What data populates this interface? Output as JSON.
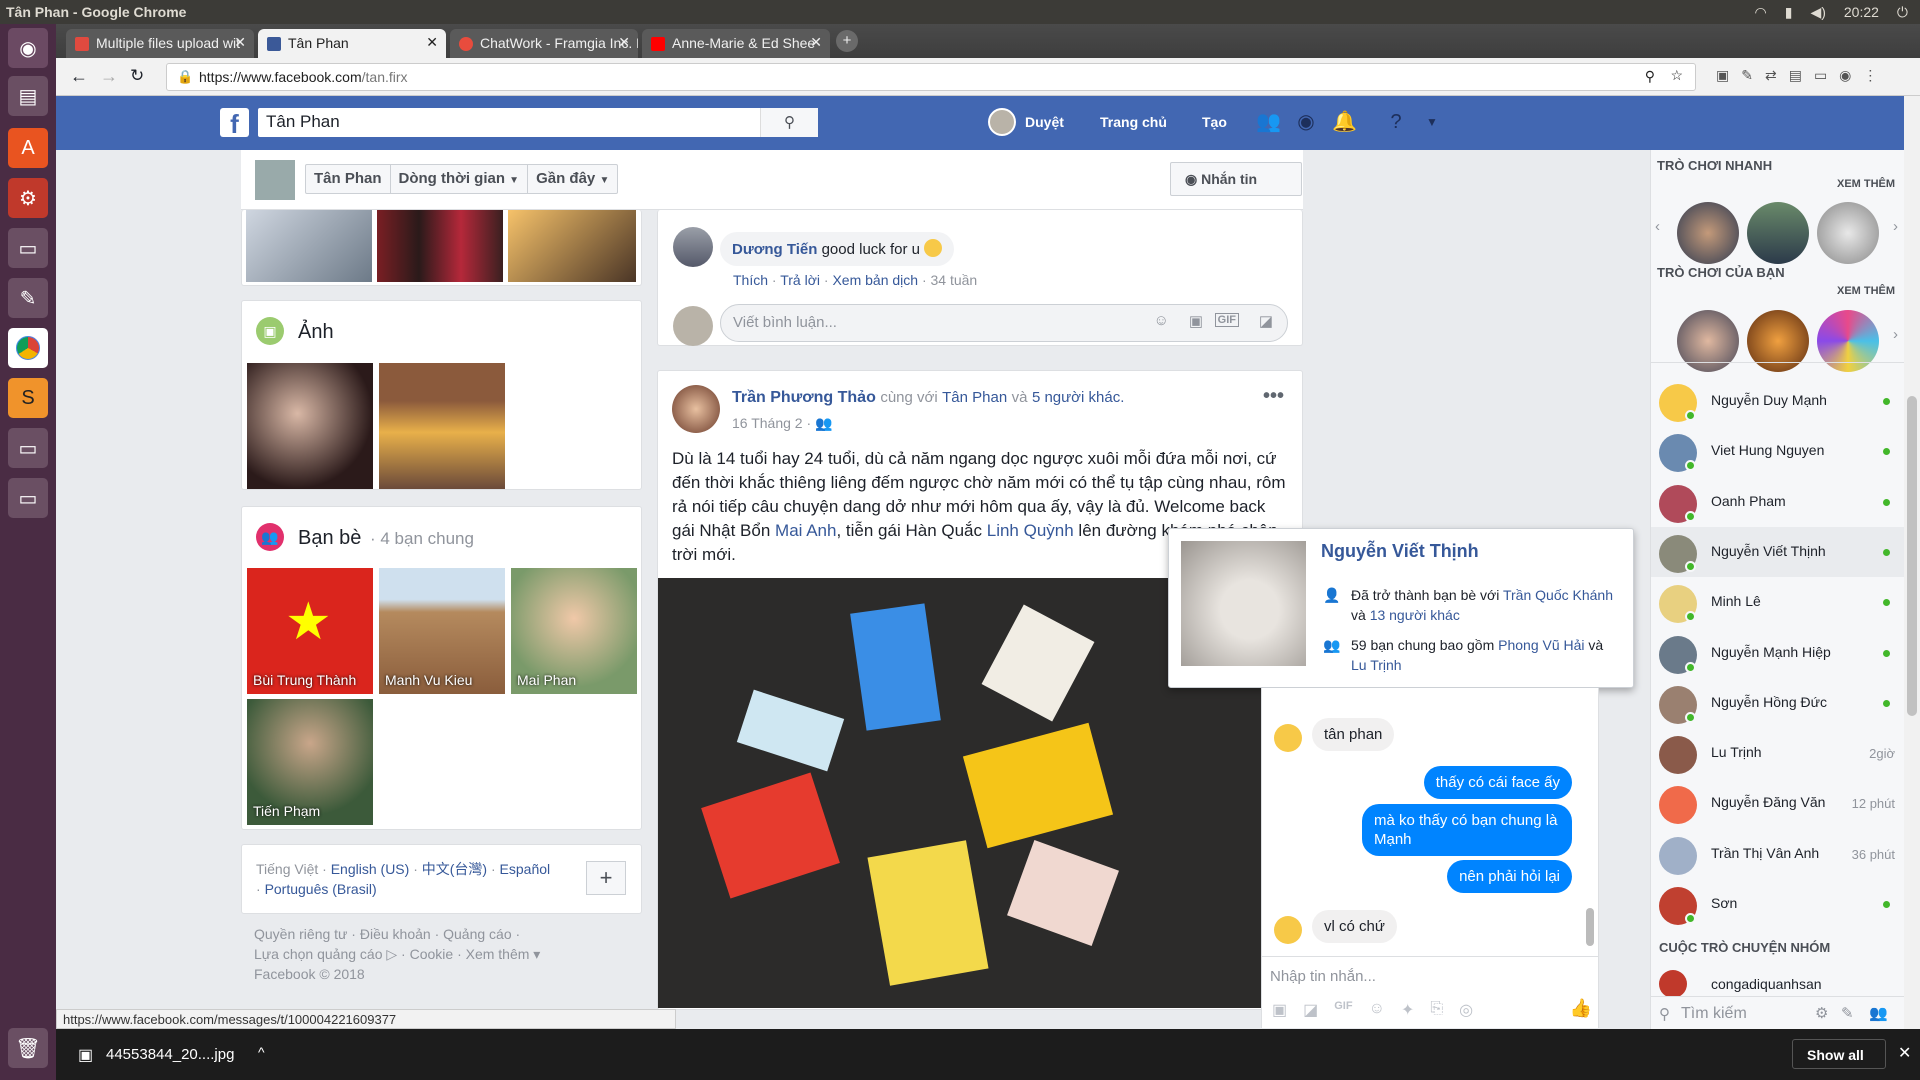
{
  "os": {
    "window_title": "Tân Phan - Google Chrome",
    "clock": "20:22",
    "indicators": [
      "wifi",
      "battery",
      "volume"
    ]
  },
  "browser": {
    "tabs": [
      {
        "label": "Multiple files upload wit",
        "favicon_color": "#e04a3f",
        "active": false
      },
      {
        "label": "Tân Phan",
        "favicon_color": "#3b5998",
        "active": true
      },
      {
        "label": "ChatWork - Framgia Inc. M",
        "favicon_color": "#e84c3d",
        "active": false
      },
      {
        "label": "Anne-Marie & Ed Shee",
        "favicon_color": "#ff0000",
        "active": false
      }
    ],
    "url": "https://www.facebook.com/tan.firx",
    "url_host": "https://www.facebook.com",
    "url_path": "/tan.firx"
  },
  "fb_header": {
    "search_value": "Tân Phan",
    "nav": {
      "profile": "Duyệt",
      "home": "Trang chủ",
      "create": "Tạo"
    }
  },
  "profile_bar": {
    "name": "Tân Phan",
    "timeline": "Dòng thời gian",
    "recent": "Gần đây",
    "message_button": "Nhắn tin"
  },
  "left_col": {
    "photos_title": "Ảnh",
    "friends_title": "Bạn bè",
    "mutual": "· 4 bạn chung",
    "friends": [
      {
        "name": "Bùi Trung Thành"
      },
      {
        "name": "Manh Vu Kieu"
      },
      {
        "name": "Mai Phan"
      },
      {
        "name": "Tiến Phạm"
      }
    ],
    "languages": {
      "current": "Tiếng Việt ·",
      "options": [
        "English (US)",
        "中文(台灣)",
        "Español",
        "Português (Brasil)"
      ]
    },
    "footer_links": "Quyền riêng tư · Điều khoản · Quảng cáo ·",
    "footer_links2": "Lựa chọn quảng cáo",
    "footer_links3": "· Cookie · Xem thêm ▾",
    "copyright": "Facebook © 2018"
  },
  "comment": {
    "author": "Dương Tiến",
    "text": "good luck for u",
    "like": "Thích",
    "reply": "Trả lời",
    "translate": "Xem bản dịch",
    "time": "· 34 tuần",
    "write_placeholder": "Viết bình luận..."
  },
  "post": {
    "author": "Trần Phương Thảo",
    "with_text": "cùng với",
    "tagged": "Tân Phan",
    "and_text": "và",
    "others": "5 người khác.",
    "date": "16 Tháng 2 ·",
    "body": "Dù là 14 tuổi hay 24 tuổi, dù cả năm ngang dọc ngược xuôi mỗi đứa mỗi nơi, cứ đến thời khắc thiêng liêng đếm ngược chờ năm mới có thể tụ tập cùng nhau, rôm rả nói tiếp câu chuyện dang dở như mới hôm qua ấy, vậy là đủ. Welcome back gái Nhật Bổn",
    "mention1": "Mai Anh",
    "body2": ", tiễn gái Hàn Quắc",
    "mention2": "Linh Quỳnh",
    "body3": "lên đường khám phá chân trời mới."
  },
  "hovercard": {
    "name": "Nguyễn Viết Thịnh",
    "line1_pre": "Đã trở thành bạn bè với",
    "line1_link": "Trần Quốc Khánh",
    "line1_mid": "và",
    "line1_link2": "13 người khác",
    "line2_pre": "59 bạn chung bao gồm",
    "line2_link": "Phong Vũ Hải",
    "line2_mid": "và",
    "line2_link2": "Lu Trịnh"
  },
  "chat": {
    "messages": [
      {
        "from": "them",
        "text": "tân phan"
      },
      {
        "from": "me",
        "text": "thấy có cái face ấy"
      },
      {
        "from": "me",
        "text": "mà ko thấy có bạn chung là Mạnh"
      },
      {
        "from": "me",
        "text": "nên phải hỏi lại"
      },
      {
        "from": "them",
        "text": "vl có chứ"
      }
    ],
    "input_placeholder": "Nhập tin nhắn..."
  },
  "right_sidebar": {
    "quick_games": "TRÒ CHƠI NHANH",
    "see_all": "XEM THÊM",
    "your_games": "TRÒ CHƠI CỦA BẠN",
    "see_all2": "XEM THÊM",
    "contacts": [
      {
        "name": "Nguyễn Duy Mạnh",
        "online": true,
        "time": ""
      },
      {
        "name": "Viet Hung Nguyen",
        "online": true,
        "time": ""
      },
      {
        "name": "Oanh Pham",
        "online": true,
        "time": ""
      },
      {
        "name": "Nguyễn Viết Thịnh",
        "online": true,
        "time": ""
      },
      {
        "name": "Minh Lê",
        "online": true,
        "time": ""
      },
      {
        "name": "Nguyễn Mạnh Hiệp",
        "online": true,
        "time": ""
      },
      {
        "name": "Nguyễn Hồng Đức",
        "online": true,
        "time": ""
      },
      {
        "name": "Lu Trịnh",
        "online": false,
        "time": "2giờ"
      },
      {
        "name": "Nguyễn Đăng Văn",
        "online": false,
        "time": "12 phút"
      },
      {
        "name": "Trần Thị Vân Anh",
        "online": false,
        "time": "36 phút"
      },
      {
        "name": "Sơn",
        "online": true,
        "time": ""
      }
    ],
    "group_chats": "CUỘC TRÒ CHUYỆN NHÓM",
    "group_item": "congadiquanhsan",
    "search_placeholder": "Tìm kiếm"
  },
  "status_url": "https://www.facebook.com/messages/t/100004221609377",
  "download": {
    "file": "44553844_20....jpg",
    "show_all": "Show all"
  }
}
